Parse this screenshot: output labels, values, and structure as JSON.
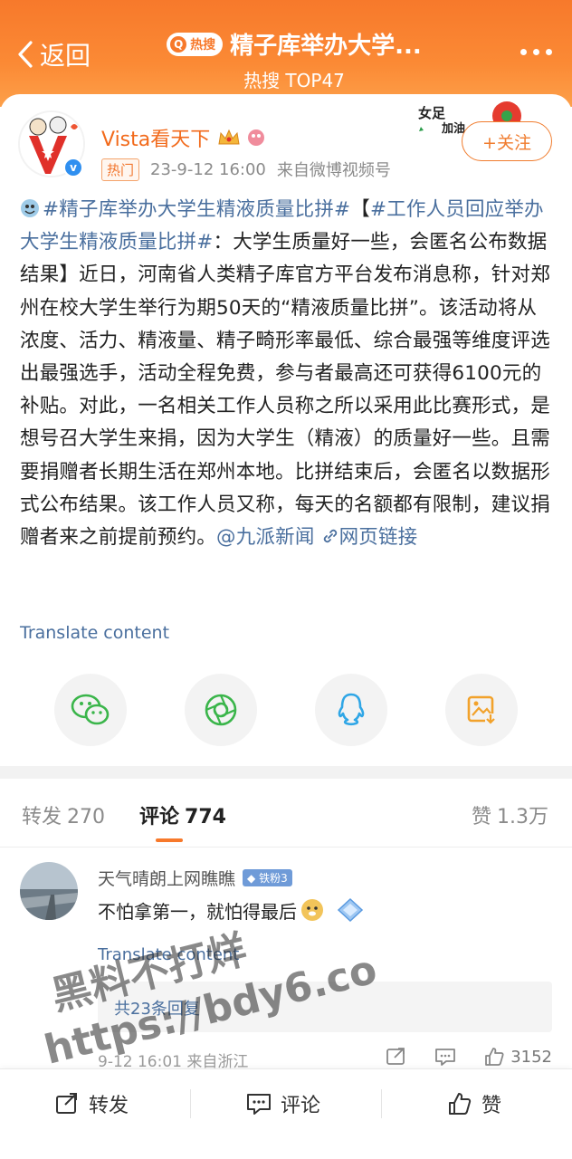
{
  "header": {
    "back_label": "返回",
    "hot_badge": "热搜",
    "title": "精子库举办大学...",
    "subtitle": "热搜 TOP47"
  },
  "author": {
    "name": "Vista看天下",
    "tag": "热门",
    "time": "23-9-12 16:00",
    "source": "来自微博视频号",
    "follow_label": "+关注",
    "deco_text": "女足加油"
  },
  "post": {
    "hashtag1": "#精子库举办大学生精液质量比拼#",
    "bracket_open": "【",
    "hashtag2": "#工作人员回应举办大学生精液质量比拼#",
    "body": "：大学生质量好一些，会匿名公布数据结果】近日，河南省人类精子库官方平台发布消息称，针对郑州在校大学生举行为期50天的“精液质量比拼”。该活动将从浓度、活力、精液量、精子畸形率最低、综合最强等维度评选出最强选手，活动全程免费，参与者最高还可获得6100元的补贴。对此，一名相关工作人员称之所以采用此比赛形式，是想号召大学生来捐，因为大学生（精液）的质量好一些。且需要捐赠者长期生活在郑州本地。比拼结束后，会匿名以数据形式公布结果。该工作人员又称，每天的名额都有限制，建议捐赠者来之前提前预约。",
    "mention": "@九派新闻",
    "web_link": "网页链接",
    "translate": "Translate content"
  },
  "share_icons": [
    "wechat-icon",
    "moments-icon",
    "qq-icon",
    "save-image-icon"
  ],
  "tabs": {
    "repost_label": "转发",
    "repost_count": "270",
    "comment_label": "评论",
    "comment_count": "774",
    "like_label": "赞",
    "like_count": "1.3万"
  },
  "comment": {
    "user": "天气晴朗上网瞧瞧",
    "badge": "铁粉3",
    "text": "不怕拿第一，就怕得最后",
    "translate": "Translate content",
    "replies": "共23条回复",
    "time_location": "9-12 16:01 来自浙江",
    "like_count": "3152"
  },
  "bottom": {
    "repost": "转发",
    "comment": "评论",
    "like": "赞"
  },
  "watermark": {
    "line1": "黑料不打烊",
    "line2": "https://bdy6.co"
  },
  "colors": {
    "brand_orange": "#f7792b",
    "link_blue": "#4a6f9e",
    "username_orange": "#f26a1b"
  }
}
